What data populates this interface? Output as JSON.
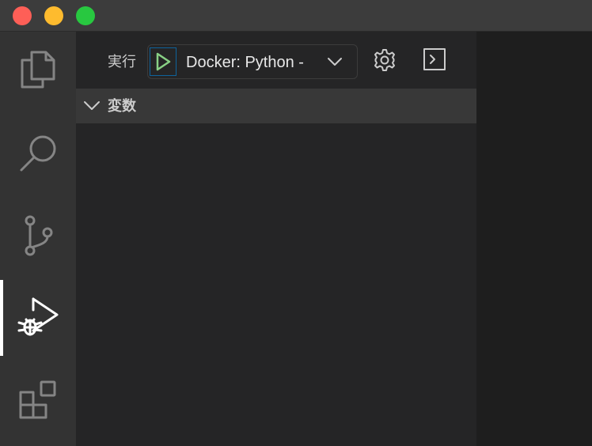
{
  "debug_toolbar": {
    "run_label": "実行",
    "configuration": "Docker: Python -"
  },
  "variables_section": {
    "title": "変数"
  },
  "activity_bar": {
    "items": [
      "explorer",
      "search",
      "source-control",
      "run-and-debug",
      "extensions"
    ],
    "active": "run-and-debug"
  },
  "icons": {
    "start": "play-icon",
    "settings": "gear-icon",
    "console": "terminal-icon",
    "dropdown": "chevron-down-icon"
  },
  "colors": {
    "play_icon": "#89d185",
    "start_border": "#0e639c",
    "close": "#fe5f57",
    "minimize": "#febb2e",
    "maximize": "#28c840"
  }
}
